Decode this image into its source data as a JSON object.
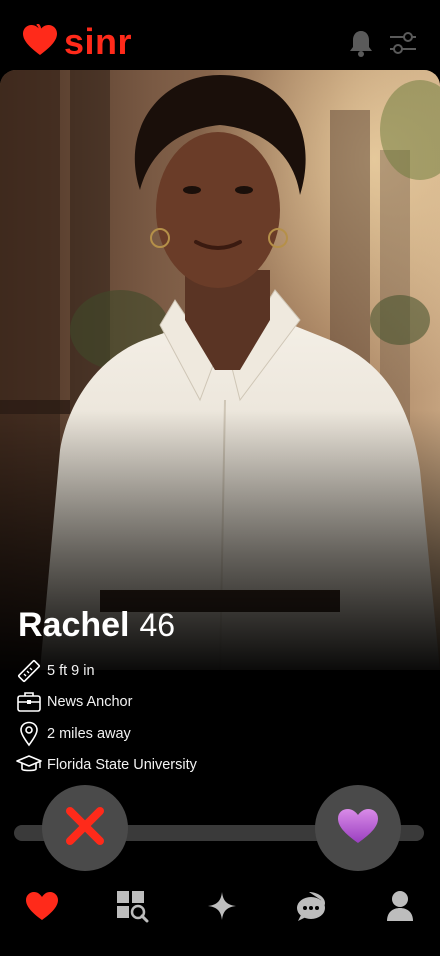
{
  "app": {
    "name": "sinr"
  },
  "header": {
    "notification_icon": "bell-icon",
    "filter_icon": "filter-sliders-icon"
  },
  "profile": {
    "name": "Rachel",
    "age": "46",
    "details": [
      {
        "icon": "ruler-icon",
        "text": "5 ft 9 in"
      },
      {
        "icon": "briefcase-icon",
        "text": "News Anchor"
      },
      {
        "icon": "location-pin-icon",
        "text": "2 miles away"
      },
      {
        "icon": "graduation-cap-icon",
        "text": "Florida State University"
      }
    ]
  },
  "actions": {
    "nope_icon": "red-x-icon",
    "like_icon": "purple-heart-icon"
  },
  "nav": {
    "items": [
      {
        "icon": "heart-icon",
        "active": true
      },
      {
        "icon": "explore-grid-icon",
        "active": false
      },
      {
        "icon": "sparkle-icon",
        "active": false
      },
      {
        "icon": "chat-bubbles-icon",
        "active": false
      },
      {
        "icon": "profile-icon",
        "active": false
      }
    ]
  },
  "colors": {
    "brand": "#ff2a1a",
    "background": "#000000",
    "like": "#b05fd6",
    "nope": "#ff2a1a",
    "nav_inactive": "#bdbdbd"
  }
}
